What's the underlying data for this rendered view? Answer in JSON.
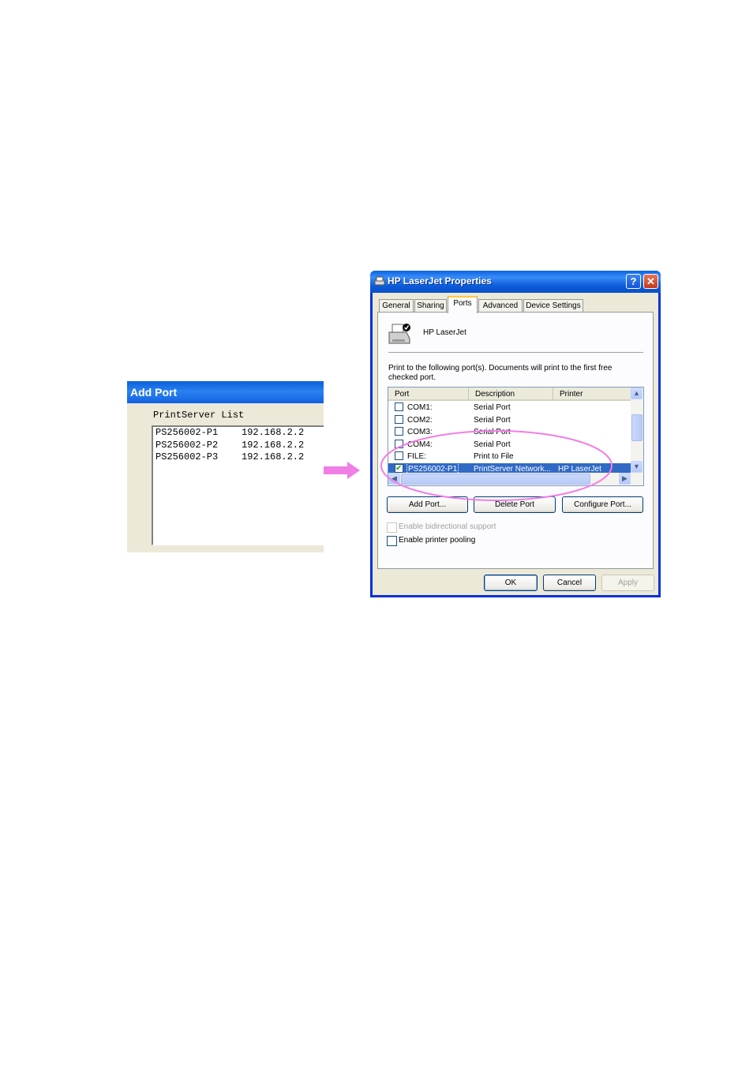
{
  "add_port": {
    "title": "Add Port",
    "list_label": "PrintServer List",
    "items": [
      {
        "name": "PS256002-P1",
        "ip": "192.168.2.2"
      },
      {
        "name": "PS256002-P2",
        "ip": "192.168.2.2"
      },
      {
        "name": "PS256002-P3",
        "ip": "192.168.2.2"
      }
    ]
  },
  "dialog": {
    "title": "HP LaserJet Properties",
    "help_glyph": "?",
    "close_glyph": "✕",
    "tabs": [
      "General",
      "Sharing",
      "Ports",
      "Advanced",
      "Device Settings"
    ],
    "active_tab": "Ports",
    "printer_name": "HP LaserJet",
    "intro": "Print to the following port(s). Documents will print to the first free checked port.",
    "columns": [
      "Port",
      "Description",
      "Printer"
    ],
    "ports": [
      {
        "port": "COM1:",
        "description": "Serial Port",
        "printer": "",
        "checked": false
      },
      {
        "port": "COM2:",
        "description": "Serial Port",
        "printer": "",
        "checked": false
      },
      {
        "port": "COM3:",
        "description": "Serial Port",
        "printer": "",
        "checked": false
      },
      {
        "port": "COM4:",
        "description": "Serial Port",
        "printer": "",
        "checked": false
      },
      {
        "port": "FILE:",
        "description": "Print to File",
        "printer": "",
        "checked": false
      },
      {
        "port": "PS256002-P1",
        "description": "PrintServer Network...",
        "printer": "HP LaserJet",
        "checked": true,
        "selected": true
      }
    ],
    "buttons": {
      "add_port": "Add Port...",
      "delete_port": "Delete Port",
      "configure_port": "Configure Port..."
    },
    "options": {
      "bidirectional": "Enable bidirectional support",
      "pooling": "Enable printer pooling"
    },
    "footer": {
      "ok": "OK",
      "cancel": "Cancel",
      "apply": "Apply"
    }
  },
  "colors": {
    "highlight_ellipse": "#f07ee6",
    "arrow": "#f07ee6",
    "selection": "#316ac5"
  }
}
